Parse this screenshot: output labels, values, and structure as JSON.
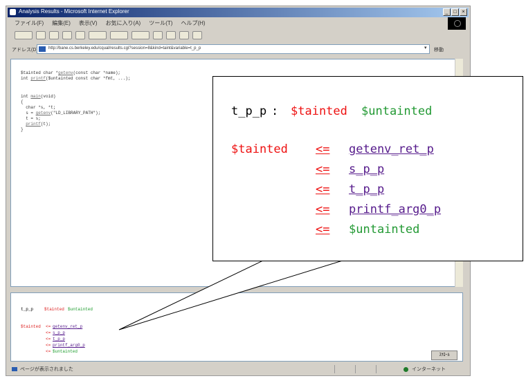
{
  "window": {
    "title": "Analysis Results - Microsoft Internet Explorer"
  },
  "titlebar_buttons": {
    "minimize": "_",
    "maximize": "□",
    "close": "×"
  },
  "menu": [
    "ファイル(F)",
    "編集(E)",
    "表示(V)",
    "お気に入り(A)",
    "ツール(T)",
    "ヘルプ(H)"
  ],
  "address": {
    "label": "アドレス(D)",
    "url": "http://bane.cs.berkeley.edu/cqual/results.cgi?session=8&kind=taint&variable=t_p_p",
    "go": "移動"
  },
  "source_code": [
    {
      "pre": "$tainted char *",
      "fn": "getenv",
      "post": "(const char *name);"
    },
    {
      "pre": "int ",
      "fn": "printf",
      "post": "($untainted const char *fmt, ...);"
    },
    {
      "pre": "",
      "fn": "",
      "post": ""
    },
    {
      "pre": "int ",
      "fn": "main",
      "post": "(void)"
    },
    {
      "pre": "{",
      "fn": "",
      "post": ""
    },
    {
      "pre": "  char *s, *t;",
      "fn": "",
      "post": ""
    },
    {
      "pre": "  s = ",
      "fn": "getenv",
      "post": "(\"LD_LIBRARY_PATH\");"
    },
    {
      "pre": "  t = s;",
      "fn": "",
      "post": ""
    },
    {
      "pre": "  ",
      "fn": "printf",
      "post": "(t);"
    },
    {
      "pre": "}",
      "fn": "",
      "post": ""
    }
  ],
  "analysis": {
    "variable": "t_p_p",
    "qualifiers": [
      "$tainted",
      "$untainted"
    ],
    "arrow": "<=",
    "chain_start": "$tainted",
    "path": [
      {
        "name": "getenv_ret_p",
        "kind": "link"
      },
      {
        "name": "s_p_p",
        "kind": "link"
      },
      {
        "name": "t_p_p",
        "kind": "link"
      },
      {
        "name": "printf_arg0_p",
        "kind": "link"
      },
      {
        "name": "$untainted",
        "kind": "qualifier"
      }
    ]
  },
  "zoom_control": "ｽｸﾛｰﾙ",
  "status": {
    "text": "ページが表示されました",
    "zone": "インターネット"
  },
  "colors": {
    "tainted": "#ee1111",
    "untainted": "#229933",
    "link": "#551a8b",
    "title_bar": "#0a246a"
  }
}
